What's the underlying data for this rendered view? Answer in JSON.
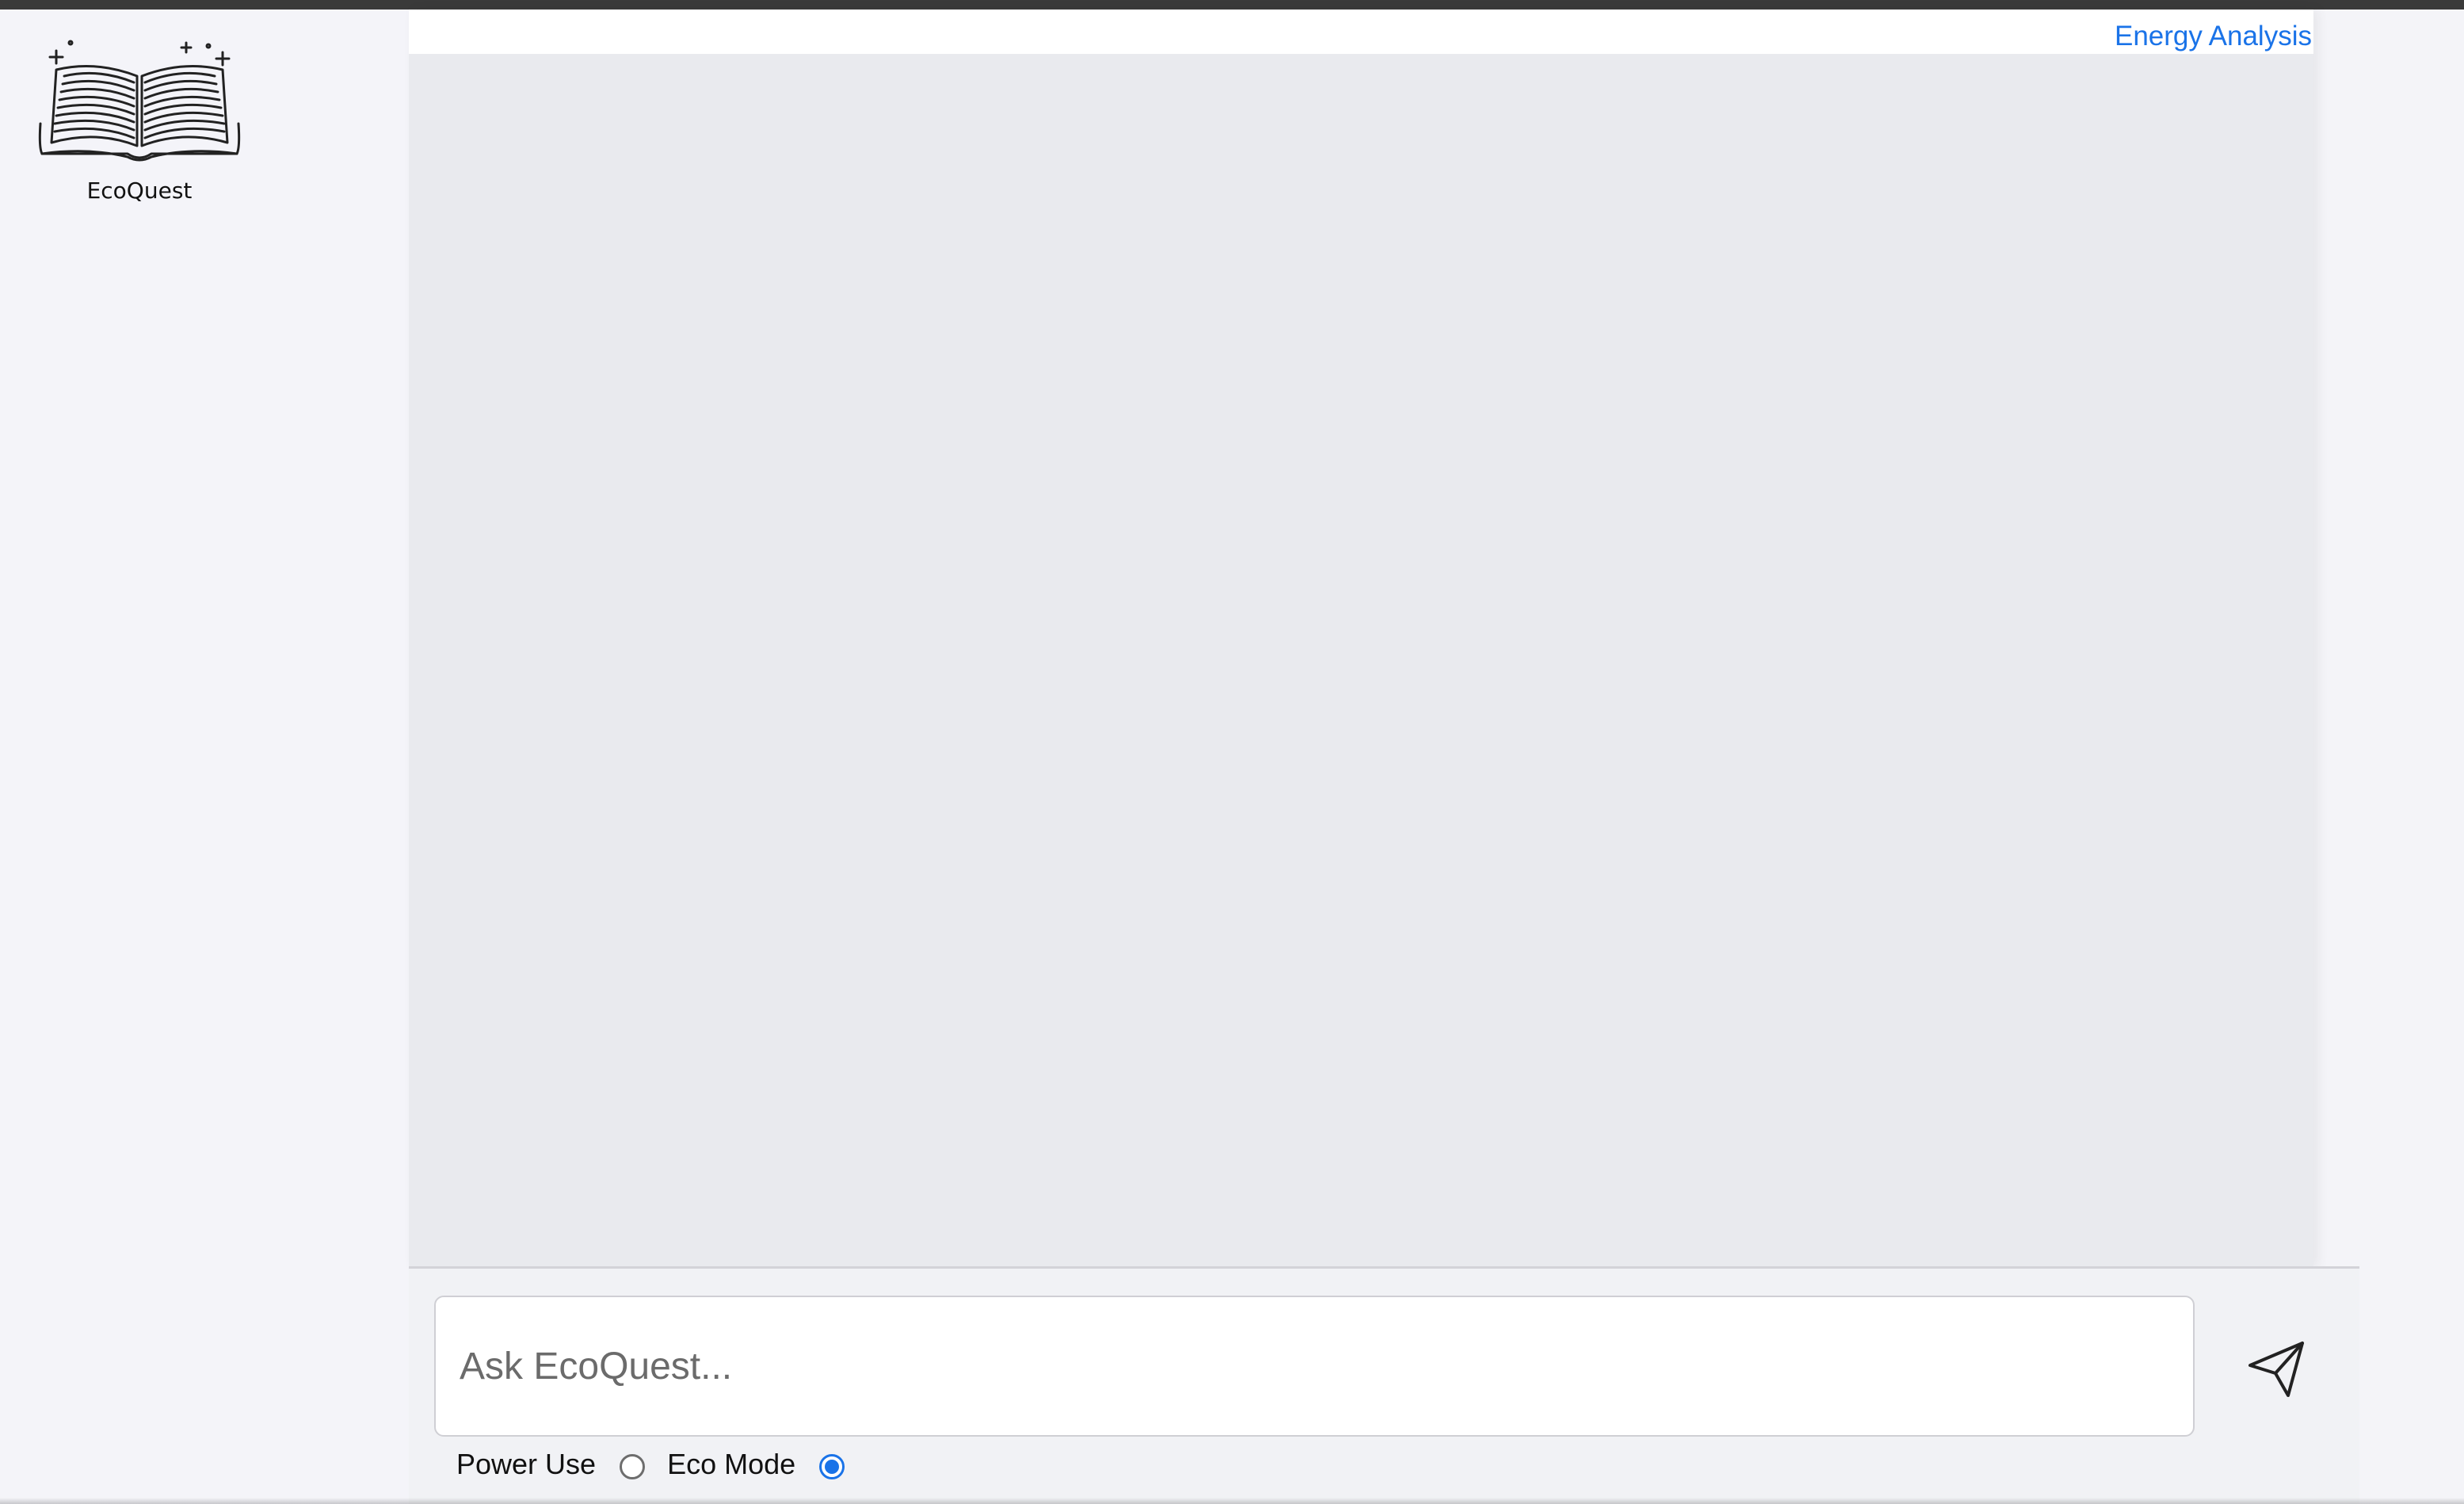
{
  "app": {
    "name": "EcoQuest",
    "logo_icon": "open-book-icon"
  },
  "header": {
    "link_label": "Energy Analysis",
    "accent_color": "#1a73e8"
  },
  "chat": {
    "placeholder": "Ask EcoQuest...",
    "value": "",
    "send_icon": "send-icon"
  },
  "modes": {
    "power_use_label": "Power Use",
    "eco_mode_label": "Eco Mode",
    "selected": "Eco Mode"
  }
}
